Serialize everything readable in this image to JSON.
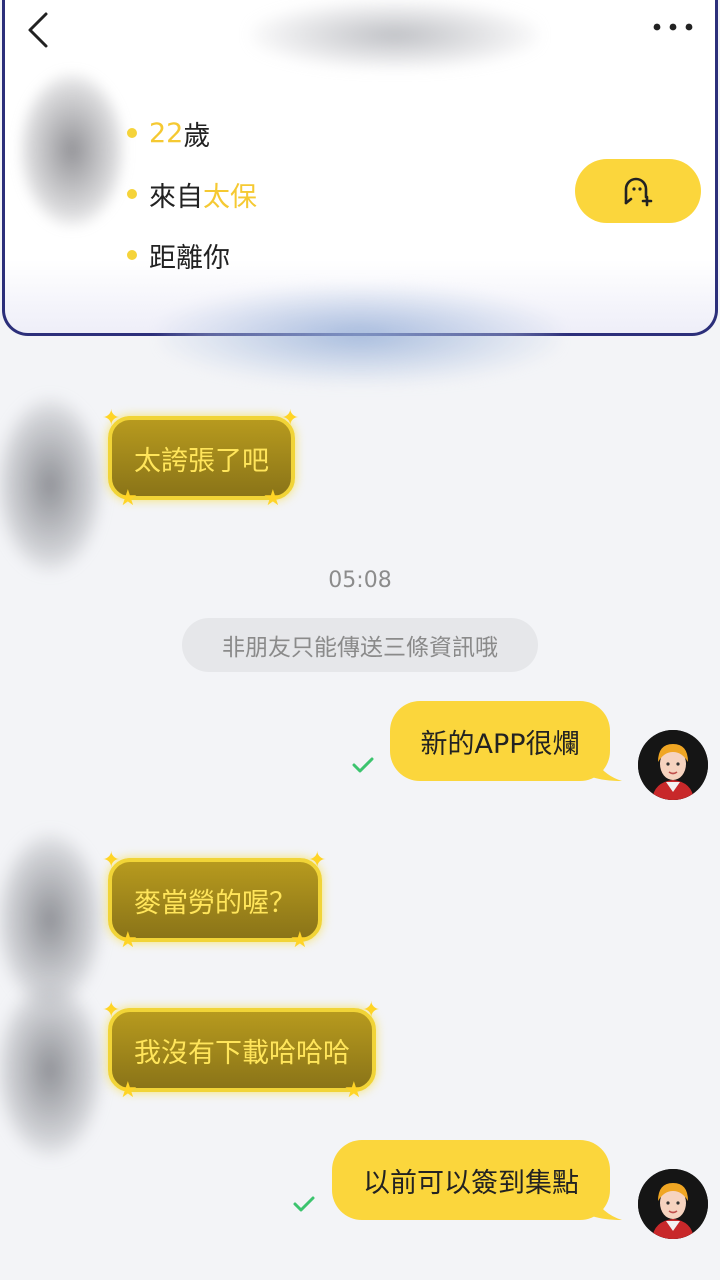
{
  "header": {
    "back_icon": "chevron-left-icon",
    "more_icon": "more-horizontal-icon"
  },
  "profile": {
    "age_number": "22",
    "age_unit": "歲",
    "from_prefix": "來自",
    "from_place": "太保",
    "distance_label": "距離你",
    "add_friend_icon": "add-friend-icon",
    "accent_color": "#fbd63c"
  },
  "chat": {
    "timestamp": "05:08",
    "system_notice": "非朋友只能傳送三條資訊哦",
    "messages": [
      {
        "from": "peer",
        "text": "太誇張了吧"
      },
      {
        "from": "me",
        "text": "新的APP很爛",
        "status": "check-icon"
      },
      {
        "from": "peer",
        "text": "麥當勞的喔？"
      },
      {
        "from": "peer",
        "text": "我沒有下載哈哈哈"
      },
      {
        "from": "me",
        "text": "以前可以簽到集點",
        "status": "check-icon"
      }
    ]
  }
}
